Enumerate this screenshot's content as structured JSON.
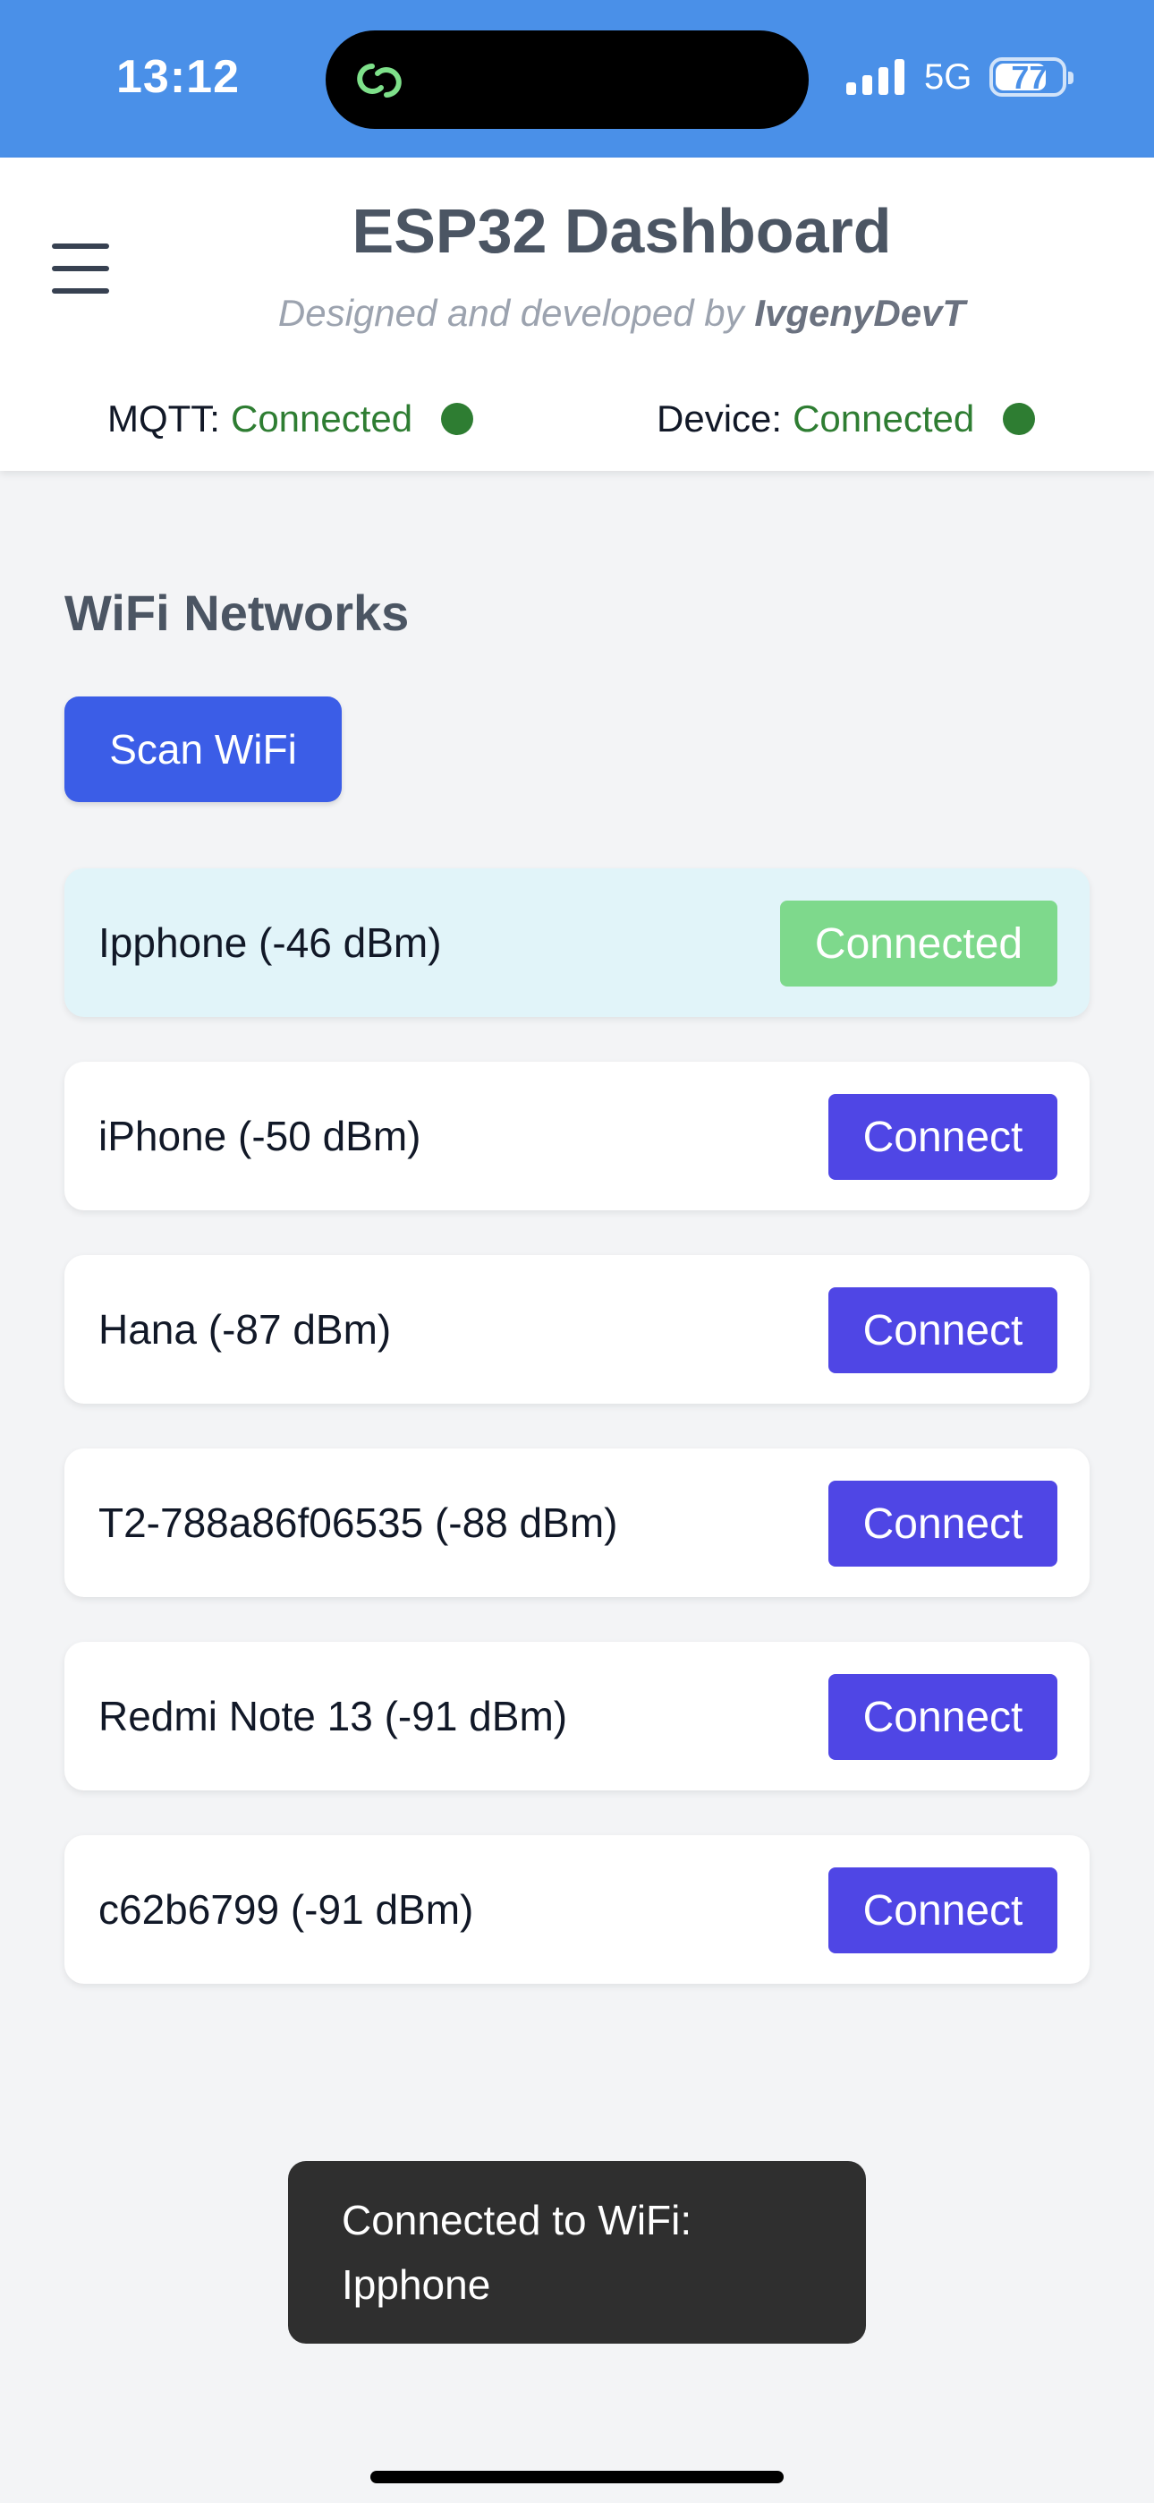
{
  "status_bar": {
    "time": "13:12",
    "network": "5G",
    "battery_level": "77",
    "battery_fraction": 0.77,
    "island_icon": "chat-link-icon",
    "signal_icon": "cellular-signal-icon"
  },
  "header": {
    "title": "ESP32 Dashboard",
    "subtitle_prefix": "Designed and developed by",
    "subtitle_author": "IvgenyDevT",
    "menu_icon": "hamburger-menu-icon",
    "mqtt_label": "MQTT:",
    "mqtt_status": "Connected",
    "device_label": "Device:",
    "device_status": "Connected",
    "status_color": "#2e7d32"
  },
  "wifi": {
    "section_title": "WiFi Networks",
    "scan_label": "Scan WiFi",
    "networks": [
      {
        "name": "Ipphone (-46 dBm)",
        "action": "Connected",
        "active": true
      },
      {
        "name": "iPhone (-50 dBm)",
        "action": "Connect",
        "active": false
      },
      {
        "name": "Hana (-87 dBm)",
        "action": "Connect",
        "active": false
      },
      {
        "name": "T2-788a86f06535 (-88 dBm)",
        "action": "Connect",
        "active": false
      },
      {
        "name": "Redmi Note 13 (-91 dBm)",
        "action": "Connect",
        "active": false
      },
      {
        "name": "c62b6799 (-91 dBm)",
        "action": "Connect",
        "active": false
      }
    ]
  },
  "toast": {
    "line1": "Connected to WiFi:",
    "line2": "Ipphone"
  },
  "colors": {
    "status_bar": "#4a90e8",
    "primary_button": "#3b5de7",
    "connect_button": "#4f46e5",
    "connected_button": "#7ed98c",
    "active_row": "#e1f4f9"
  }
}
